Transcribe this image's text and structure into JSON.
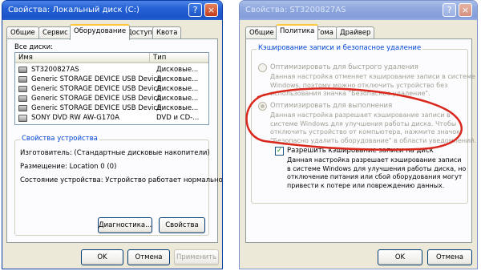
{
  "left_window": {
    "title": "Свойства: Локальный диск (C:)",
    "tabs": [
      "Общие",
      "Сервис",
      "Оборудование",
      "Доступ",
      "Квота"
    ],
    "active_tab": "Оборудование",
    "all_disks_label": "Все диски:",
    "list_headers": {
      "name": "Имя",
      "type": "Тип"
    },
    "disks": [
      {
        "name": "ST3200827AS",
        "type": "Дисковые..."
      },
      {
        "name": "Generic STORAGE DEVICE USB Device",
        "type": "Дисковые..."
      },
      {
        "name": "Generic STORAGE DEVICE USB Device",
        "type": "Дисковые..."
      },
      {
        "name": "Generic STORAGE DEVICE USB Device",
        "type": "Дисковые..."
      },
      {
        "name": "Generic STORAGE DEVICE USB Device",
        "type": "Дисковые..."
      },
      {
        "name": "SONY DVD RW AW-G170A",
        "type": "DVD и CD-..."
      }
    ],
    "device_props_group": "Свойства устройства",
    "manufacturer": "Изготовитель: (Стандартные дисковые накопители)",
    "location": "Размещение: Location 0 (0)",
    "status": "Состояние устройства: Устройство работает нормально.",
    "diagnostics_button": "Диагностика...",
    "properties_button": "Свойства",
    "ok": "OK",
    "cancel": "Отмена",
    "apply": "Применить"
  },
  "right_window": {
    "title": "Свойства: ST3200827AS",
    "tabs": [
      "Общие",
      "Политика",
      "Тома",
      "Драйвер"
    ],
    "active_tab": "Политика",
    "group_title": "Кэширование записи и безопасное удаление",
    "opt_quick": "Оптимизировать для быстрого удаления",
    "opt_quick_desc": [
      "Данная настройка отменяет кэширование записи в системе",
      "Windows, поэтому можно отключить устройство без",
      "использования значка \"Безопасное удаление\"."
    ],
    "opt_perf": "Оптимизировать для выполнения",
    "opt_perf_desc": [
      "Данная настройка разрешает кэширование записи в",
      "системе Windows для улучшения работы диска. Чтобы",
      "отключить устройство от компьютера, нажмите значок",
      "\"Безопасно удалить оборудование\" в области уведомлений."
    ],
    "write_cache": "Разрешить кэширование записи на диск",
    "write_cache_desc": [
      "Данная настройка разрешает кэширование записи",
      "в системе Windows для улучшения работы диска, но",
      "отключение питания или сбой оборудования могут",
      "привести к потере или повреждению данных."
    ],
    "ok": "OK",
    "cancel": "Отмена"
  },
  "colors": {
    "annotation": "#d9271c",
    "titlebar": "#2561d6",
    "group_label": "#0046d5"
  }
}
